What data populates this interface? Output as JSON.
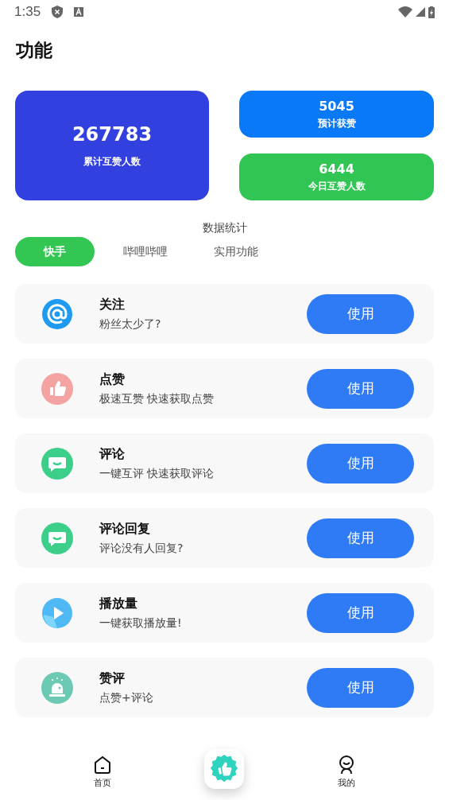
{
  "status_bar": {
    "time": "1:35"
  },
  "page": {
    "title": "功能"
  },
  "stats": [
    {
      "value": "267783",
      "label": "累计互赞人数",
      "kind": "big"
    },
    {
      "value": "5045",
      "label": "预计获赞",
      "kind": "blue"
    },
    {
      "value": "6444",
      "label": "今日互赞人数",
      "kind": "green"
    }
  ],
  "section_title": "数据统计",
  "tabs": [
    {
      "label": "快手",
      "selected": true
    },
    {
      "label": "哔哩哔哩",
      "selected": false
    },
    {
      "label": "实用功能",
      "selected": false
    }
  ],
  "features": [
    {
      "kind": "at",
      "title": "关注",
      "subtitle": "粉丝太少了?",
      "button": "使用"
    },
    {
      "kind": "thumb",
      "title": "点赞",
      "subtitle": "极速互赞 快速获取点赞",
      "button": "使用"
    },
    {
      "kind": "chat",
      "title": "评论",
      "subtitle": "一键互评 快速获取评论",
      "button": "使用"
    },
    {
      "kind": "chat",
      "title": "评论回复",
      "subtitle": "评论没有人回复?",
      "button": "使用"
    },
    {
      "kind": "play",
      "title": "播放量",
      "subtitle": "一键获取播放量!",
      "button": "使用"
    },
    {
      "kind": "alarm",
      "title": "赞评",
      "subtitle": "点赞+评论",
      "button": "使用"
    }
  ],
  "bottom_nav": [
    {
      "kind": "home",
      "label": "首页"
    },
    {
      "kind": "center"
    },
    {
      "kind": "me",
      "label": "我的"
    }
  ]
}
